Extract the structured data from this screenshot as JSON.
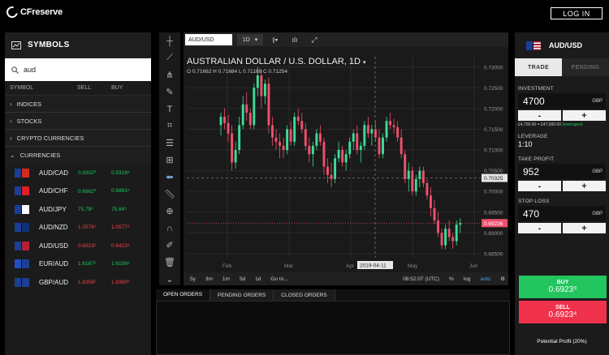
{
  "brand": {
    "name": "CFreserve"
  },
  "header": {
    "login_label": "LOG IN"
  },
  "symbols": {
    "title": "SYMBOLS",
    "search_value": "aud",
    "columns": {
      "symbol": "SYMBOL",
      "sell": "SELL",
      "buy": "BUY"
    },
    "categories": [
      "INDICES",
      "STOCKS",
      "CRYPTO CURRENCIES",
      "CURRENCIES"
    ],
    "rows": [
      {
        "pair": "AUD/CAD",
        "sell": "0.9302⁰",
        "buy": "0.9318⁸",
        "sell_dir": "up",
        "buy_dir": "up",
        "flag_a": "#1c3f95",
        "flag_b": "#d52b1e"
      },
      {
        "pair": "AUD/CHF",
        "sell": "0.6862⁰",
        "buy": "0.6863⁴",
        "sell_dir": "up",
        "buy_dir": "up",
        "flag_a": "#1c3f95",
        "flag_b": "#e01e24"
      },
      {
        "pair": "AUD/JPY",
        "sell": "75.78⁶",
        "buy": "75.84⁹",
        "sell_dir": "up",
        "buy_dir": "up",
        "flag_a": "#1c3f95",
        "flag_b": "#ffffff"
      },
      {
        "pair": "AUD/NZD",
        "sell": "1.0576¹",
        "buy": "1.0577⁸",
        "sell_dir": "dn",
        "buy_dir": "dn",
        "flag_a": "#1c3f95",
        "flag_b": "#12307a"
      },
      {
        "pair": "AUD/USD",
        "sell": "0.6923⁶",
        "buy": "0.6423⁸",
        "sell_dir": "dn",
        "buy_dir": "dn",
        "flag_a": "#1c3f95",
        "flag_b": "#b22234"
      },
      {
        "pair": "EUR/AUD",
        "sell": "1.6167²",
        "buy": "1.6158⁸",
        "sell_dir": "up",
        "buy_dir": "up",
        "flag_a": "#1f4fbf",
        "flag_b": "#1c3f95"
      },
      {
        "pair": "GBP/AUD",
        "sell": "1.8358¹",
        "buy": "1.8360⁰",
        "sell_dir": "dn",
        "buy_dir": "dn",
        "flag_a": "#1c3f95",
        "flag_b": "#1c3f95"
      }
    ]
  },
  "chart_toolbar": {
    "symbol": "AUD/USD",
    "timeframe": "1D"
  },
  "chart_data": {
    "type": "candlestick",
    "title": "AUSTRALIAN DOLLAR / U.S. DOLLAR, 1D",
    "ohlc_text": "O 0.71662  H 0.71684  L 0.71168  C 0.71254",
    "y_ticks": [
      "0.73000",
      "0.72500",
      "0.72000",
      "0.71500",
      "0.71000",
      "0.70500",
      "0.70000",
      "0.69500",
      "0.69000",
      "0.68500"
    ],
    "x_ticks": [
      "Feb",
      "Mar",
      "Apr",
      "May",
      "Jun"
    ],
    "ylim": [
      0.684,
      0.7325
    ],
    "price_labels": [
      {
        "value": 0.70325,
        "text": "0.70325",
        "kind": "crosshair"
      },
      {
        "value": 0.69236,
        "text": "0.69236",
        "kind": "last"
      }
    ],
    "crosshair_date": "2019-04-11",
    "candles": [
      [
        0.716,
        0.719,
        0.7135,
        0.718
      ],
      [
        0.718,
        0.72,
        0.715,
        0.7165
      ],
      [
        0.7165,
        0.7185,
        0.712,
        0.714
      ],
      [
        0.714,
        0.716,
        0.705,
        0.707
      ],
      [
        0.707,
        0.712,
        0.7055,
        0.71
      ],
      [
        0.71,
        0.718,
        0.709,
        0.716
      ],
      [
        0.716,
        0.723,
        0.715,
        0.721
      ],
      [
        0.721,
        0.724,
        0.717,
        0.719
      ],
      [
        0.719,
        0.72,
        0.715,
        0.716
      ],
      [
        0.716,
        0.726,
        0.715,
        0.725
      ],
      [
        0.725,
        0.73,
        0.723,
        0.728
      ],
      [
        0.728,
        0.7295,
        0.72,
        0.723
      ],
      [
        0.723,
        0.727,
        0.721,
        0.726
      ],
      [
        0.726,
        0.7275,
        0.714,
        0.716
      ],
      [
        0.716,
        0.718,
        0.711,
        0.713
      ],
      [
        0.713,
        0.715,
        0.71,
        0.712
      ],
      [
        0.712,
        0.714,
        0.708,
        0.711
      ],
      [
        0.711,
        0.713,
        0.708,
        0.71
      ],
      [
        0.71,
        0.716,
        0.709,
        0.715
      ],
      [
        0.715,
        0.717,
        0.711,
        0.712
      ],
      [
        0.712,
        0.719,
        0.711,
        0.718
      ],
      [
        0.718,
        0.72,
        0.716,
        0.717
      ],
      [
        0.717,
        0.719,
        0.714,
        0.715
      ],
      [
        0.715,
        0.7165,
        0.71,
        0.711
      ],
      [
        0.711,
        0.713,
        0.707,
        0.709
      ],
      [
        0.709,
        0.712,
        0.706,
        0.711
      ],
      [
        0.711,
        0.715,
        0.71,
        0.714
      ],
      [
        0.714,
        0.716,
        0.711,
        0.712
      ],
      [
        0.712,
        0.713,
        0.704,
        0.706
      ],
      [
        0.706,
        0.708,
        0.702,
        0.704
      ],
      [
        0.704,
        0.707,
        0.701,
        0.703
      ],
      [
        0.703,
        0.709,
        0.702,
        0.708
      ],
      [
        0.708,
        0.712,
        0.707,
        0.71
      ],
      [
        0.71,
        0.711,
        0.706,
        0.707
      ],
      [
        0.707,
        0.71,
        0.705,
        0.709
      ],
      [
        0.709,
        0.713,
        0.708,
        0.712
      ],
      [
        0.712,
        0.715,
        0.71,
        0.714
      ],
      [
        0.714,
        0.716,
        0.709,
        0.71
      ],
      [
        0.71,
        0.712,
        0.707,
        0.711
      ],
      [
        0.711,
        0.717,
        0.71,
        0.716
      ],
      [
        0.716,
        0.718,
        0.713,
        0.714
      ],
      [
        0.714,
        0.716,
        0.711,
        0.715
      ],
      [
        0.715,
        0.717,
        0.712,
        0.713
      ],
      [
        0.713,
        0.715,
        0.708,
        0.709
      ],
      [
        0.709,
        0.714,
        0.708,
        0.713
      ],
      [
        0.713,
        0.718,
        0.712,
        0.717
      ],
      [
        0.717,
        0.719,
        0.715,
        0.716
      ],
      [
        0.716,
        0.7175,
        0.714,
        0.7155
      ],
      [
        0.7155,
        0.717,
        0.712,
        0.713
      ],
      [
        0.713,
        0.715,
        0.708,
        0.709
      ],
      [
        0.709,
        0.71,
        0.702,
        0.703
      ],
      [
        0.703,
        0.707,
        0.7,
        0.705
      ],
      [
        0.705,
        0.706,
        0.699,
        0.7
      ],
      [
        0.7,
        0.704,
        0.699,
        0.703
      ],
      [
        0.703,
        0.706,
        0.701,
        0.705
      ],
      [
        0.705,
        0.706,
        0.701,
        0.702
      ],
      [
        0.702,
        0.703,
        0.698,
        0.699
      ],
      [
        0.699,
        0.701,
        0.694,
        0.696
      ],
      [
        0.696,
        0.698,
        0.692,
        0.693
      ],
      [
        0.693,
        0.695,
        0.689,
        0.69
      ],
      [
        0.69,
        0.691,
        0.686,
        0.687
      ],
      [
        0.687,
        0.692,
        0.686,
        0.691
      ],
      [
        0.691,
        0.693,
        0.688,
        0.689
      ],
      [
        0.689,
        0.69,
        0.6862,
        0.688
      ],
      [
        0.688,
        0.693,
        0.687,
        0.692
      ],
      [
        0.692,
        0.6935,
        0.69,
        0.6924
      ]
    ],
    "up_color": "#3ddc97",
    "down_color": "#f0506e"
  },
  "chart_bottom": {
    "ranges": [
      "5y",
      "3m",
      "1m",
      "5d",
      "1d",
      "Go to..."
    ],
    "time": "08:52:07 (UTC)",
    "pct": "%",
    "log": "log",
    "auto": "auto"
  },
  "orders": {
    "tabs": [
      "OPEN ORDERS",
      "PENDING ORDERS",
      "CLOSED ORDERS"
    ]
  },
  "trade": {
    "symbol": "AUD/USD",
    "tabs": [
      "TRADE",
      "PENDING"
    ],
    "investment_label": "INVESTMENT",
    "investment_value": "4700",
    "investment_unit": "GBP",
    "investment_note_plain": "£4,700.00 = £47,000.00 ",
    "investment_note_green": "(leveraged)",
    "leverage_label": "LEVERAGE",
    "leverage_value": "1:10",
    "take_profit_label": "TAKE PROFIT",
    "take_profit_value": "952",
    "take_profit_unit": "GBP",
    "stop_loss_label": "STOP LOSS",
    "stop_loss_value": "470",
    "stop_loss_unit": "GBP",
    "minus": "-",
    "plus": "+",
    "buy_label": "BUY",
    "buy_price": "0.6923⁹",
    "sell_label": "SELL",
    "sell_price": "0.6923⁴",
    "potential_profit": "Potential Profit (20%)"
  }
}
